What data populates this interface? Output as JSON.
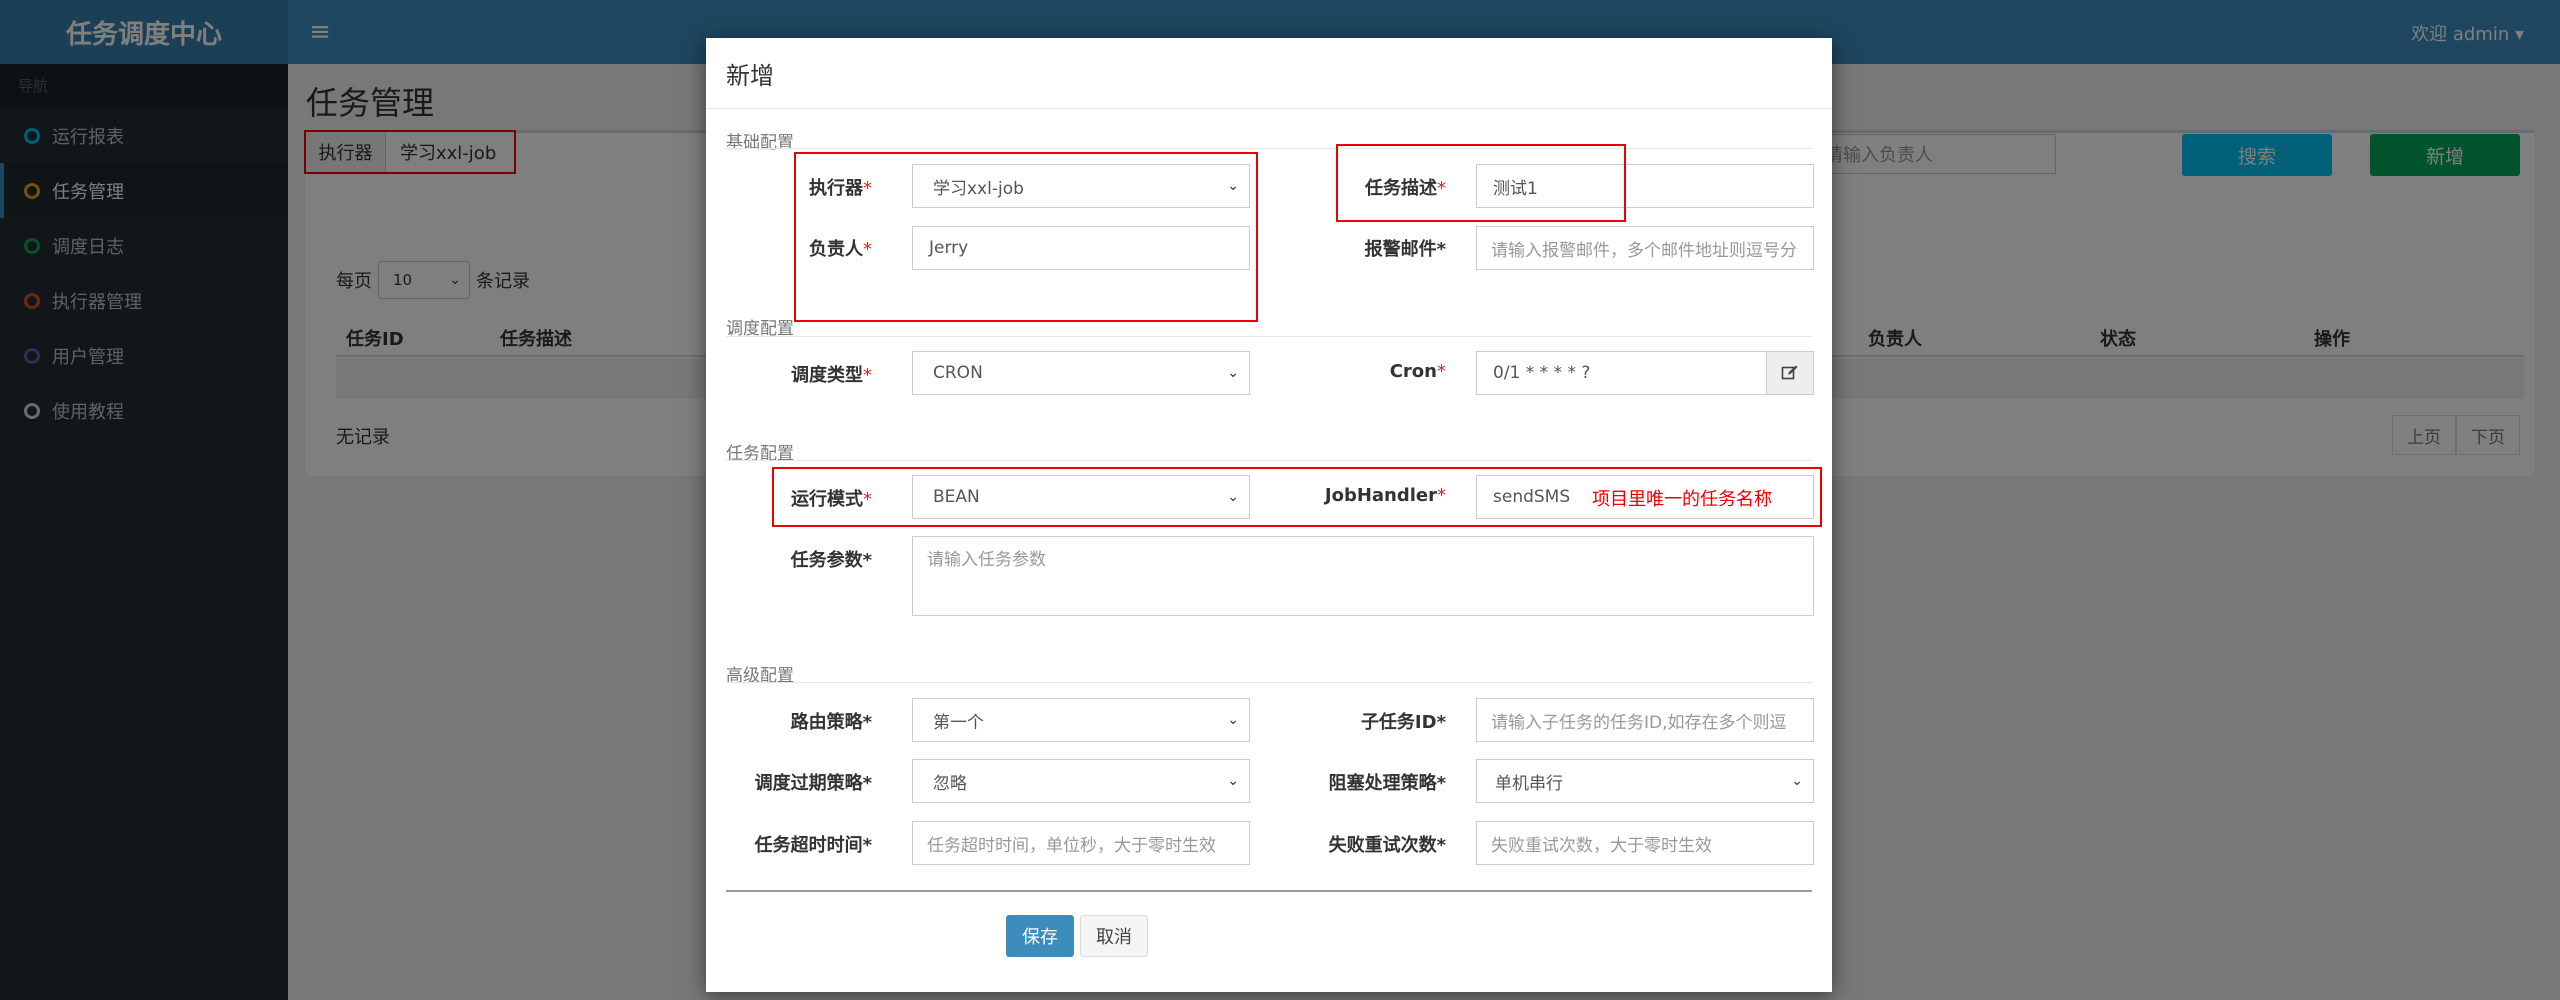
{
  "header": {
    "app_title": "任务调度中心",
    "user_menu": "欢迎 admin ▾",
    "menu_icon": "≡"
  },
  "sidebar": {
    "header": "导航",
    "items": [
      {
        "label": "运行报表",
        "color": "#00c0ef"
      },
      {
        "label": "任务管理",
        "color": "#f39c12"
      },
      {
        "label": "调度日志",
        "color": "#00a65a"
      },
      {
        "label": "执行器管理",
        "color": "#dd4b39"
      },
      {
        "label": "用户管理",
        "color": "#605ca8"
      },
      {
        "label": "使用教程",
        "color": "#d2d6de"
      }
    ]
  },
  "page": {
    "title": "任务管理",
    "filter_label": "执行器",
    "filter_value": "学习xxl-job",
    "owner_placeholder": "请输入负责人",
    "search_label": "搜索",
    "add_label": "新增",
    "page_size_prefix": "每页",
    "page_size": "10",
    "page_size_suffix": "条记录",
    "columns": [
      "任务ID",
      "任务描述",
      "负责人",
      "状态",
      "操作"
    ],
    "no_records": "无记录",
    "prev_label": "上页",
    "next_label": "下页"
  },
  "modal": {
    "title": "新增",
    "sections": {
      "basic": "基础配置",
      "schedule": "调度配置",
      "task": "任务配置",
      "advanced": "高级配置"
    },
    "fields": {
      "executor": {
        "label": "执行器",
        "value": "学习xxl-job"
      },
      "job_desc": {
        "label": "任务描述",
        "value": "测试1"
      },
      "author": {
        "label": "负责人",
        "value": "Jerry"
      },
      "alarm_email": {
        "label": "报警邮件*",
        "placeholder": "请输入报警邮件，多个邮件地址则逗号分"
      },
      "schedule_type": {
        "label": "调度类型",
        "value": "CRON"
      },
      "cron": {
        "label": "Cron",
        "value": "0/1 * * * * ?"
      },
      "glue_type": {
        "label": "运行模式",
        "value": "BEAN"
      },
      "job_handler": {
        "label": "JobHandler",
        "value": "sendSMS"
      },
      "job_param": {
        "label": "任务参数*",
        "placeholder": "请输入任务参数"
      },
      "route_strategy": {
        "label": "路由策略*",
        "value": "第一个"
      },
      "child_job_id": {
        "label": "子任务ID*",
        "placeholder": "请输入子任务的任务ID,如存在多个则逗"
      },
      "misfire_strategy": {
        "label": "调度过期策略*",
        "value": "忽略"
      },
      "block_strategy": {
        "label": "阻塞处理策略*",
        "value": "单机串行"
      },
      "timeout": {
        "label": "任务超时时间*",
        "placeholder": "任务超时时间，单位秒，大于零时生效"
      },
      "fail_retry": {
        "label": "失败重试次数*",
        "placeholder": "失败重试次数，大于零时生效"
      }
    },
    "annotation": "项目里唯一的任务名称",
    "save_label": "保存",
    "cancel_label": "取消"
  }
}
